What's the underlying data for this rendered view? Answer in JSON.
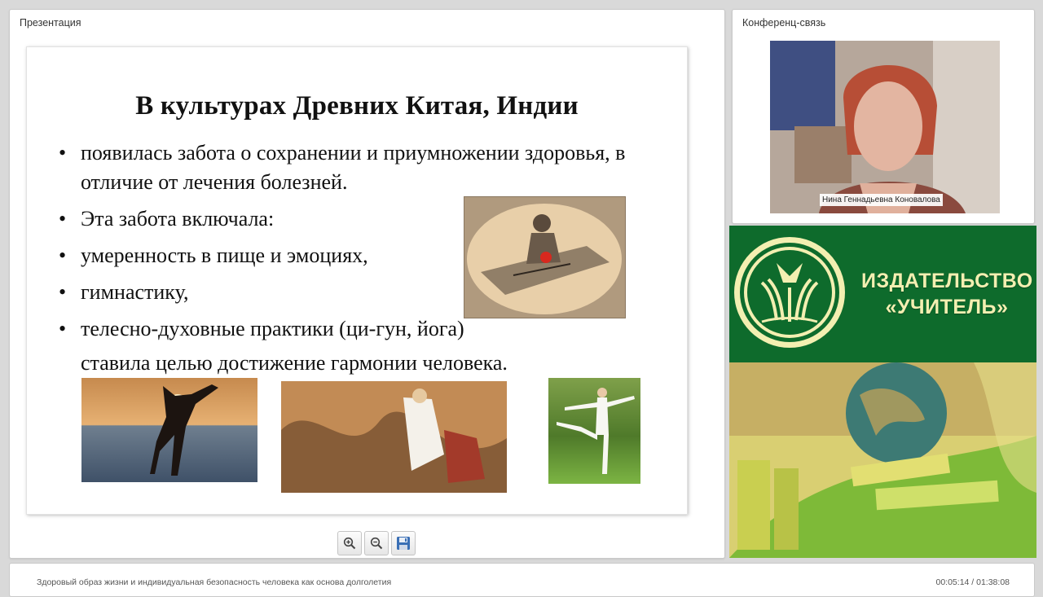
{
  "presentation_panel": {
    "title": "Презентация"
  },
  "slide": {
    "title": "В культурах Древних Китая, Индии",
    "bullets": [
      "появилась забота о сохранении и приумножении здоровья, в отличие от лечения болезней.",
      "Эта забота включала:",
      "умеренность в пище и эмоциях,",
      "гимнастику,",
      "телесно-духовные практики (ци-гун, йога)"
    ],
    "closing": "ставила целью достижение гармонии человека."
  },
  "toolbar": {
    "zoom_in_icon": "zoom-in-icon",
    "zoom_out_icon": "zoom-out-icon",
    "save_icon": "save-icon"
  },
  "conference_panel": {
    "title": "Конференц-связь",
    "speaker_name": "Нина Геннадьевна Коновалова"
  },
  "ad": {
    "brand_line1": "ИЗДАТЕЛЬСТВО",
    "brand_line2": "«УЧИТЕЛЬ»",
    "colors": {
      "green": "#0e6b2c",
      "cream": "#f3efb1",
      "lime": "#cdd24d"
    }
  },
  "footer": {
    "title": "Здоровый образ жизни и индивидуальная безопасность человека как основа долголетия",
    "time": "00:05:14 / 01:38:08"
  }
}
